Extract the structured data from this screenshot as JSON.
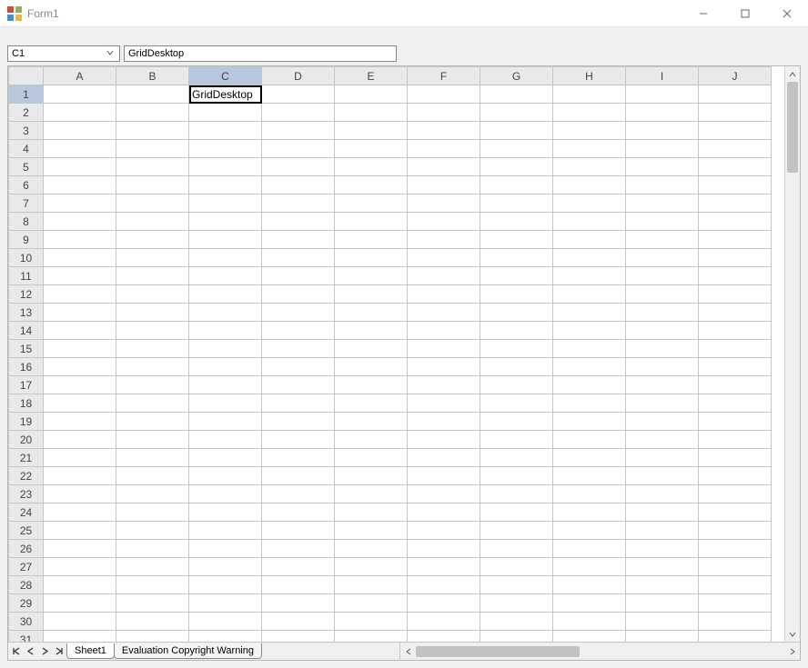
{
  "window": {
    "title": "Form1"
  },
  "formula_bar": {
    "cell_ref": "C1",
    "formula": "GridDesktop"
  },
  "grid": {
    "columns": [
      "A",
      "B",
      "C",
      "D",
      "E",
      "F",
      "G",
      "H",
      "I",
      "J"
    ],
    "visible_rows": 31,
    "selected_col_index": 2,
    "selected_row_index": 0,
    "cells": {
      "C1": "GridDesktop"
    }
  },
  "sheets": {
    "tabs": [
      {
        "label": "Sheet1",
        "active": true
      },
      {
        "label": "Evaluation Copyright Warning",
        "active": false
      }
    ]
  }
}
